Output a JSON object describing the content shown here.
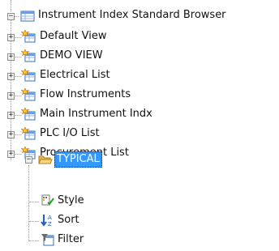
{
  "tree": {
    "root": {
      "label": "Instrument Index Standard Browser",
      "icon": "table-icon",
      "expanded": true
    },
    "views": [
      {
        "label": "Default View",
        "icon": "view-star-icon"
      },
      {
        "label": "DEMO VIEW",
        "icon": "view-star-icon"
      },
      {
        "label": "Electrical List",
        "icon": "view-star-icon"
      },
      {
        "label": "Flow Instruments",
        "icon": "view-star-icon"
      },
      {
        "label": "Main Instrument Indx",
        "icon": "view-star-icon"
      },
      {
        "label": "PLC I/O List",
        "icon": "view-star-icon"
      },
      {
        "label": "Procurement List",
        "icon": "view-star-icon"
      }
    ],
    "selected_folder": {
      "label": "TYPICAL",
      "icon": "open-folder-icon",
      "expanded": true,
      "selected": true
    },
    "folder_children": [
      {
        "label": "Style",
        "icon": "style-icon"
      },
      {
        "label": "Sort",
        "icon": "sort-icon"
      },
      {
        "label": "Filter",
        "icon": "filter-icon"
      }
    ]
  },
  "colors": {
    "selection": "#3399ff",
    "connector": "#9a9a9a"
  }
}
